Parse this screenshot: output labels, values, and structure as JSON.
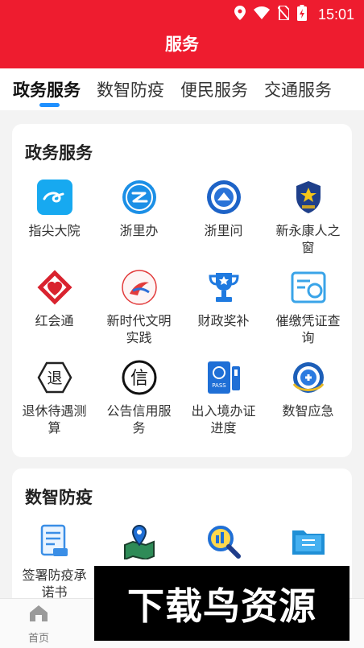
{
  "status": {
    "time": "15:01"
  },
  "appbar": {
    "title": "服务"
  },
  "tabs": [
    {
      "label": "政务服务",
      "active": true
    },
    {
      "label": "数智防疫"
    },
    {
      "label": "便民服务"
    },
    {
      "label": "交通服务"
    }
  ],
  "gov_section": {
    "title": "政务服务",
    "items": [
      {
        "label": "指尖大院",
        "icon": "fingertip-courtyard-icon"
      },
      {
        "label": "浙里办",
        "icon": "zheliban-icon"
      },
      {
        "label": "浙里问",
        "icon": "zheliwen-icon"
      },
      {
        "label": "新永康人之窗",
        "icon": "new-yongkang-window-icon"
      },
      {
        "label": "红会通",
        "icon": "red-cross-icon"
      },
      {
        "label": "新时代文明实践",
        "icon": "civilization-practice-icon"
      },
      {
        "label": "财政奖补",
        "icon": "trophy-icon"
      },
      {
        "label": "催缴凭证查询",
        "icon": "voucher-query-icon"
      },
      {
        "label": "退休待遇测算",
        "icon": "retirement-icon"
      },
      {
        "label": "公告信用服务",
        "icon": "credit-icon"
      },
      {
        "label": "出入境办证进度",
        "icon": "passport-icon"
      },
      {
        "label": "数智应急",
        "icon": "emergency-icon"
      }
    ]
  },
  "epidemic_section": {
    "title": "数智防疫",
    "items": [
      {
        "label": "签署防疫承诺书",
        "icon": "pledge-document-icon"
      },
      {
        "label": "",
        "icon": "map-pin-icon"
      },
      {
        "label": "",
        "icon": "search-magnifier-icon"
      },
      {
        "label": "",
        "icon": "folder-icon"
      }
    ]
  },
  "bottom_nav": {
    "home_label": "首页"
  },
  "watermark": {
    "text": "下载鸟资源"
  },
  "colors": {
    "brand_red": "#ee1c2f",
    "accent_blue": "#1e90ff"
  }
}
